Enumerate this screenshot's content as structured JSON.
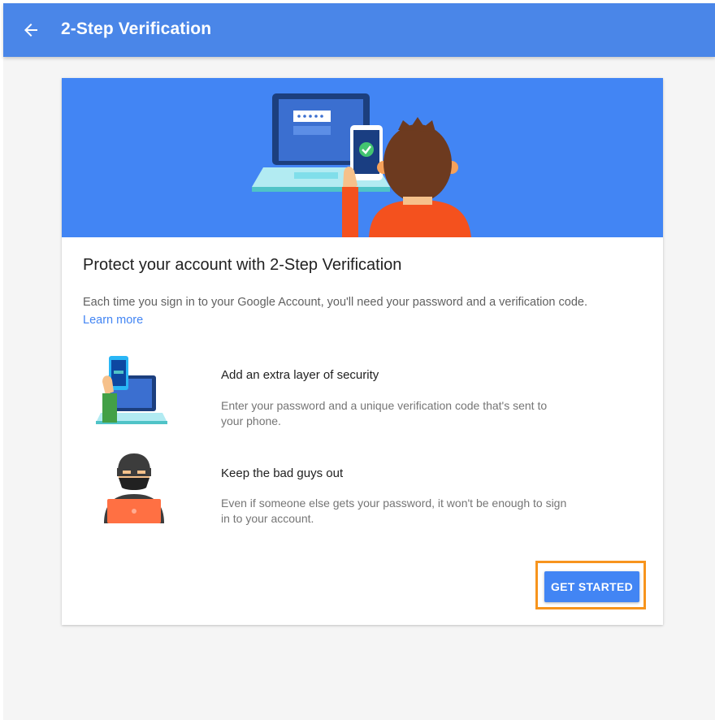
{
  "header": {
    "title": "2-Step Verification",
    "back_icon": "arrow-left-icon",
    "color": "#4a86e8"
  },
  "card": {
    "hero_color": "#4285f4",
    "headline": "Protect your account with 2-Step Verification",
    "description": "Each time you sign in to your Google Account, you'll need your password and a verification code.",
    "learn_more": "Learn more",
    "features": [
      {
        "icon": "phone-laptop-illustration",
        "title": "Add an extra layer of security",
        "text": "Enter your password and a unique verification code that's sent to your phone."
      },
      {
        "icon": "masked-hacker-illustration",
        "title": "Keep the bad guys out",
        "text": "Even if someone else gets your password, it won't be enough to sign in to your account."
      }
    ],
    "button_label": "GET STARTED",
    "highlight_color": "#f7941d"
  }
}
